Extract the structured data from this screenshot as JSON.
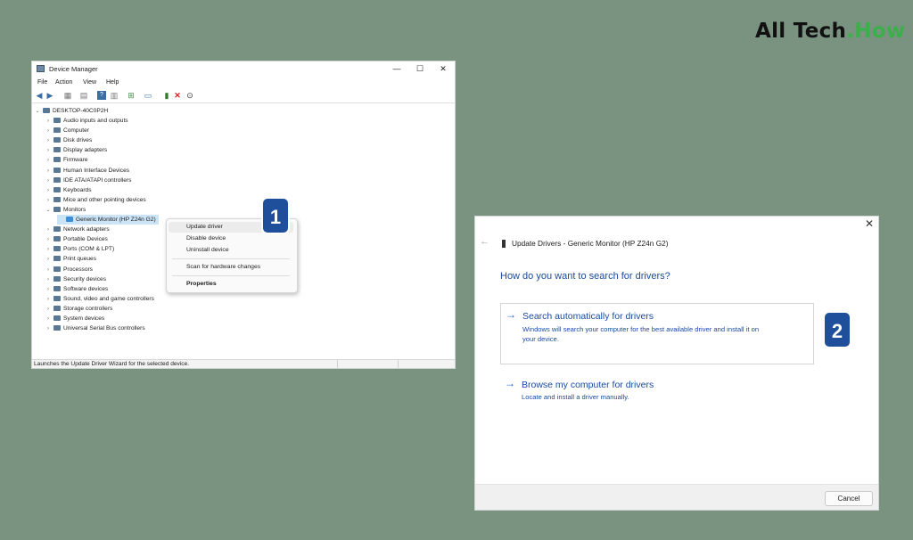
{
  "brand": {
    "part1": "All Tech",
    "dot": ".",
    "part2": "How"
  },
  "device_manager": {
    "title": "Device Manager",
    "window_buttons": {
      "minimize": "—",
      "maximize": "☐",
      "close": "✕"
    },
    "menu": [
      "File",
      "Action",
      "View",
      "Help"
    ],
    "toolbar_icons": [
      "back-icon",
      "forward-icon",
      "properties-icon",
      "list-icon",
      "help-icon",
      "view-icon",
      "scan-icon",
      "monitor-icon",
      "update-icon",
      "remove-icon",
      "download-icon"
    ],
    "root": "DESKTOP-40C0P2H",
    "categories": [
      "Audio inputs and outputs",
      "Computer",
      "Disk drives",
      "Display adapters",
      "Firmware",
      "Human Interface Devices",
      "IDE ATA/ATAPI controllers",
      "Keyboards",
      "Mice and other pointing devices",
      "Monitors",
      "Network adapters",
      "Portable Devices",
      "Ports (COM & LPT)",
      "Print queues",
      "Processors",
      "Security devices",
      "Software devices",
      "Sound, video and game controllers",
      "Storage controllers",
      "System devices",
      "Universal Serial Bus controllers"
    ],
    "selected_child": "Generic Monitor (HP Z24n G2)",
    "status_text": "Launches the Update Driver Wizard for the selected device."
  },
  "context_menu": {
    "items": [
      "Update driver",
      "Disable device",
      "Uninstall device"
    ],
    "scan": "Scan for hardware changes",
    "properties": "Properties"
  },
  "badges": {
    "one": "1",
    "two": "2"
  },
  "update_dialog": {
    "close": "✕",
    "back": "←",
    "header": "Update Drivers - Generic Monitor (HP Z24n G2)",
    "question": "How do you want to search for drivers?",
    "option1": {
      "title": "Search automatically for drivers",
      "desc1": "Windows will search your computer for the best available driver and install it on",
      "desc2": "your device."
    },
    "option2": {
      "title": "Browse my computer for drivers",
      "desc": "Locate and install a driver manually."
    },
    "arrow": "→",
    "cancel": "Cancel"
  }
}
